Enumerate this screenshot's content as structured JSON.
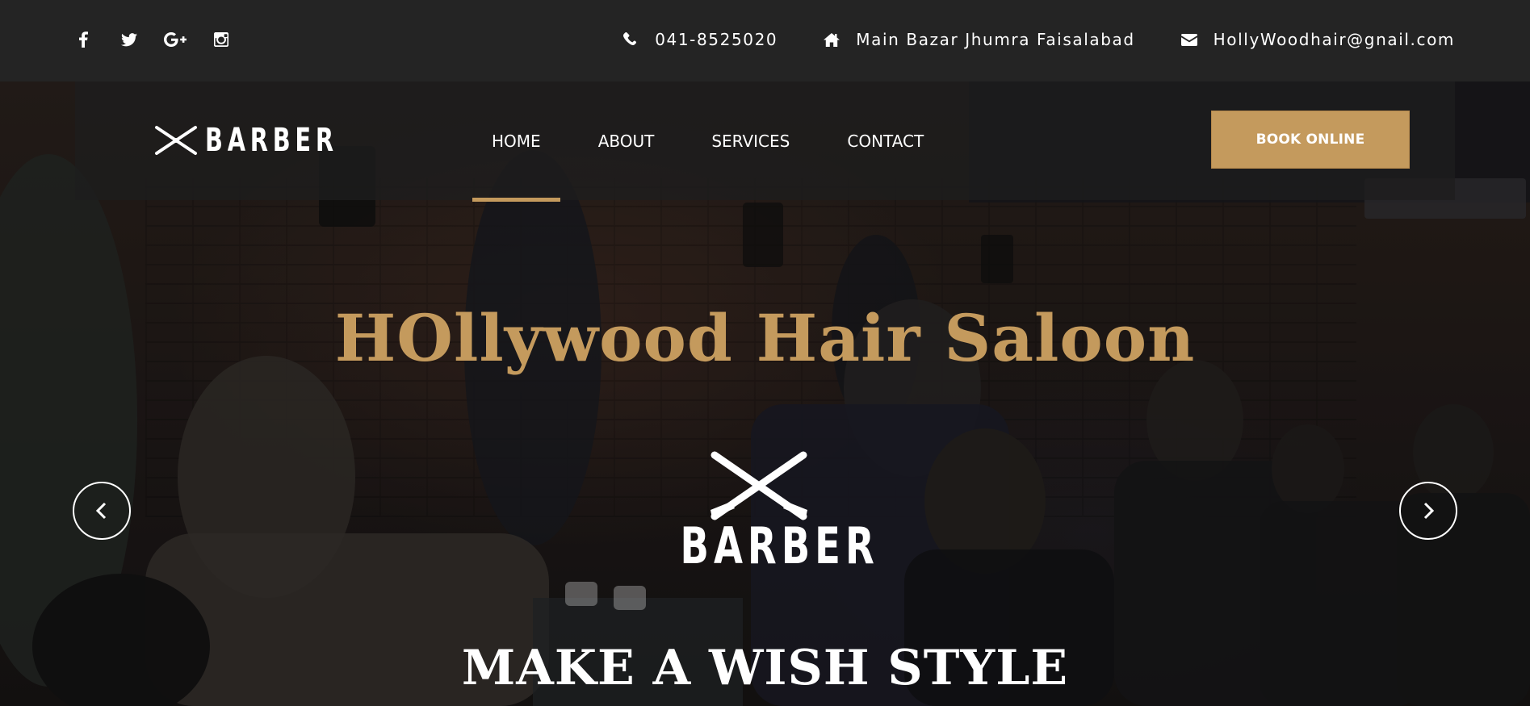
{
  "topbar": {
    "social": [
      {
        "name": "facebook-icon"
      },
      {
        "name": "twitter-icon"
      },
      {
        "name": "google-plus-icon"
      },
      {
        "name": "instagram-icon"
      }
    ],
    "phone": "041-8525020",
    "address": "Main Bazar Jhumra Faisalabad",
    "email": "HollyWoodhair@gnail.com"
  },
  "navbar": {
    "logo_text": "BARBER",
    "menu": [
      {
        "label": "HOME",
        "active": true
      },
      {
        "label": "ABOUT",
        "active": false
      },
      {
        "label": "SERVICES",
        "active": false
      },
      {
        "label": "CONTACT",
        "active": false
      }
    ],
    "book_button": "BOOK ONLINE"
  },
  "hero": {
    "title": "HOllywood Hair Saloon",
    "logo_text": "BARBER",
    "subtitle": "MAKE A WISH STYLE",
    "prev_icon": "chevron-left-icon",
    "next_icon": "chevron-right-icon"
  },
  "colors": {
    "accent": "#c49a5d",
    "topbar_bg": "#242424",
    "navbar_bg": "rgba(30,30,30,0.78)"
  }
}
